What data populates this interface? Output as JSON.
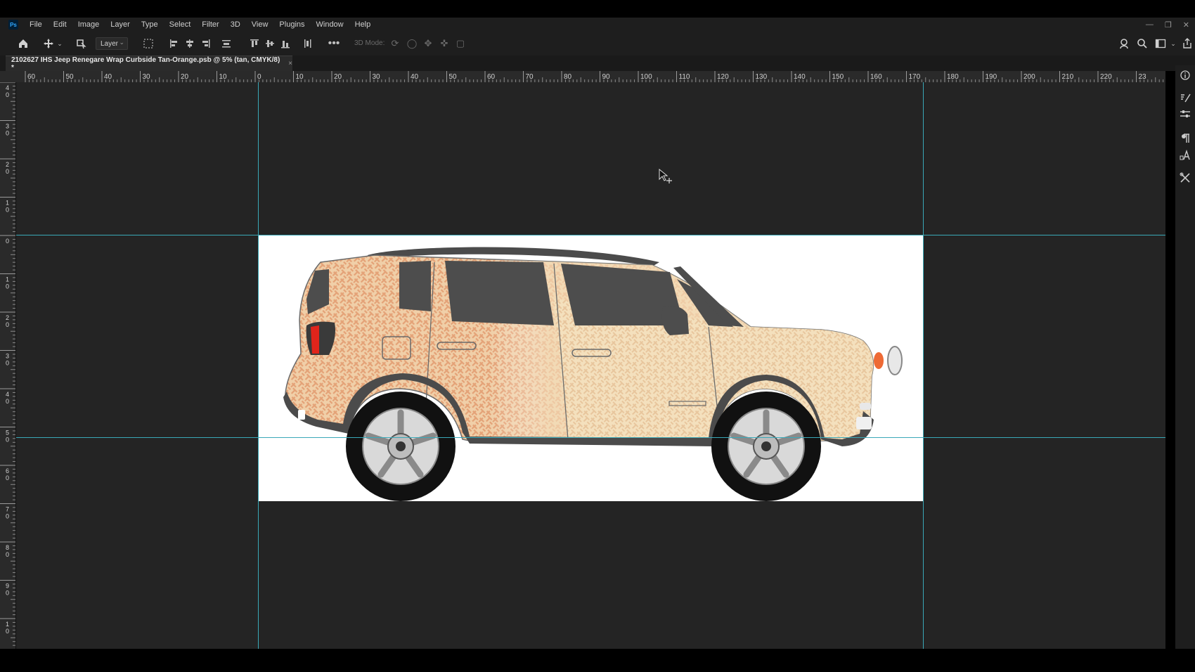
{
  "app": {
    "logo": "Ps"
  },
  "menu": [
    "File",
    "Edit",
    "Image",
    "Layer",
    "Type",
    "Select",
    "Filter",
    "3D",
    "View",
    "Plugins",
    "Window",
    "Help"
  ],
  "options_bar": {
    "layer_select": "Layer",
    "three_d_mode": "3D Mode:"
  },
  "document_tab": {
    "title": "2102627 IHS Jeep Renegare Wrap Curbside Tan-Orange.psb @ 5% (tan, CMYK/8) *",
    "close": "×"
  },
  "ruler_h_labels": [
    "60",
    "50",
    "40",
    "30",
    "20",
    "10",
    "0",
    "10",
    "20",
    "30",
    "40",
    "50",
    "60",
    "70",
    "80",
    "90",
    "100",
    "110",
    "120",
    "130",
    "140",
    "150",
    "160",
    "170",
    "180",
    "190",
    "200",
    "210",
    "220",
    "23"
  ],
  "ruler_v_labels": [
    "40",
    "30",
    "20",
    "10",
    "0",
    "10",
    "20",
    "30",
    "40",
    "50",
    "60",
    "70",
    "80",
    "90",
    "10"
  ],
  "colors": {
    "guide": "#3aa9b8",
    "canvas_bg": "#242424",
    "wrap_tan": "#f4e1be",
    "wrap_orange": "#e8a36e"
  },
  "icons": {
    "home": "home-icon",
    "move": "move-icon",
    "auto_select": "layers-icon",
    "transform": "transform-controls-icon",
    "align": "align-icons",
    "more": "more-icon",
    "search": "search-icon",
    "workspace": "workspace-icon",
    "share": "share-icon"
  }
}
